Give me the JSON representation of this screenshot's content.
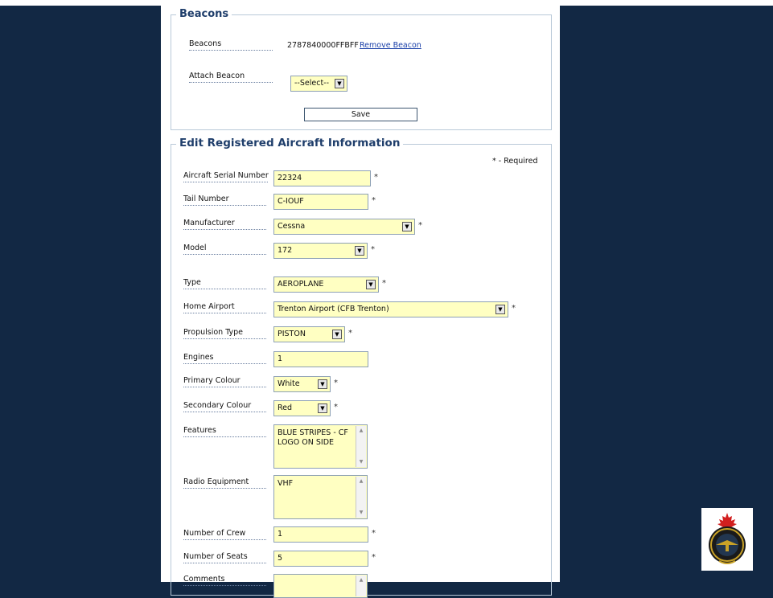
{
  "beacons_section": {
    "title": "Beacons",
    "beacons_label": "Beacons",
    "beacon_id": "2787840000FFBFF",
    "remove_beacon_link": "Remove Beacon",
    "attach_beacon_label": "Attach Beacon",
    "attach_beacon_value": "--Select--",
    "save_button": "Save"
  },
  "edit_section": {
    "title": "Edit Registered Aircraft Information",
    "required_note": "* - Required",
    "required_marker": "*",
    "fields": {
      "serial": {
        "label": "Aircraft Serial Number",
        "value": "22324"
      },
      "tail": {
        "label": "Tail Number",
        "value": "C-IOUF"
      },
      "manufacturer": {
        "label": "Manufacturer",
        "value": "Cessna"
      },
      "model": {
        "label": "Model",
        "value": "172"
      },
      "type": {
        "label": "Type",
        "value": "AEROPLANE"
      },
      "home_airport": {
        "label": "Home Airport",
        "value": "Trenton Airport (CFB Trenton)"
      },
      "propulsion": {
        "label": "Propulsion Type",
        "value": "PISTON"
      },
      "engines": {
        "label": "Engines",
        "value": "1"
      },
      "primary_colour": {
        "label": "Primary Colour",
        "value": "White"
      },
      "secondary_colour": {
        "label": "Secondary Colour",
        "value": "Red"
      },
      "features": {
        "label": "Features",
        "value": "BLUE STRIPES - CF LOGO ON SIDE"
      },
      "radio": {
        "label": "Radio Equipment",
        "value": "VHF"
      },
      "crew": {
        "label": "Number of Crew",
        "value": "1"
      },
      "seats": {
        "label": "Number of Seats",
        "value": "5"
      },
      "comments": {
        "label": "Comments",
        "value": ""
      }
    }
  },
  "icons": {
    "dropdown_arrow": "chevron-down-icon",
    "scroll_up": "scroll-up-icon",
    "scroll_down": "scroll-down-icon",
    "logo": "maple-leaf-crest-icon"
  },
  "colors": {
    "background": "#122844",
    "field_fill": "#ffffc2",
    "heading": "#1f3e6b",
    "link": "#1a3fa8"
  }
}
